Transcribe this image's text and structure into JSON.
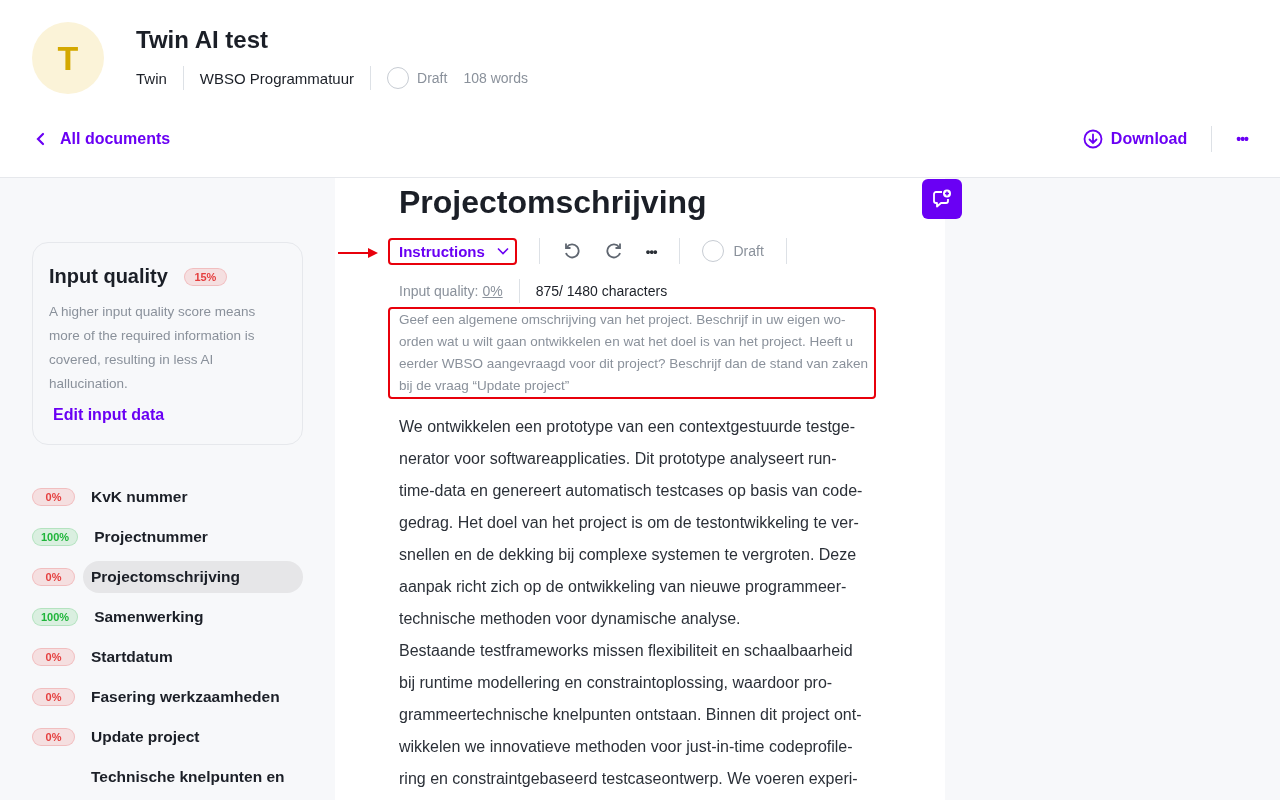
{
  "header": {
    "avatar_letter": "T",
    "title": "Twin AI test",
    "meta": [
      "Twin",
      "WBSO Programmatuur"
    ],
    "status": "Draft",
    "word_count": "108 words"
  },
  "nav": {
    "back": "All documents",
    "download": "Download",
    "more": "•••"
  },
  "sidebar": {
    "card": {
      "title": "Input quality",
      "score": "15%",
      "description": "A higher input quality score means more of the required information is covered, resulting in less AI hallucination.",
      "link": "Edit input data"
    },
    "items": [
      {
        "score": "0%",
        "color": "#e53e3e",
        "label": "KvK nummer",
        "selected": false
      },
      {
        "score": "100%",
        "color": "#1fb53a",
        "label": "Projectnummer",
        "selected": false
      },
      {
        "score": "0%",
        "color": "#e53e3e",
        "label": "Projectomschrijving",
        "selected": true
      },
      {
        "score": "100%",
        "color": "#1fb53a",
        "label": "Samenwerking",
        "selected": false
      },
      {
        "score": "0%",
        "color": "#e53e3e",
        "label": "Startdatum",
        "selected": false
      },
      {
        "score": "0%",
        "color": "#e53e3e",
        "label": "Fasering werkzaamheden",
        "selected": false
      },
      {
        "score": "0%",
        "color": "#e53e3e",
        "label": "Update project",
        "selected": false
      },
      {
        "label": "Technische knelpunten en",
        "selected": false
      }
    ]
  },
  "document": {
    "title": "Projectomschrijving",
    "toolbar": {
      "instructions": "Instructions",
      "more": "•••",
      "status": "Draft"
    },
    "input_quality_label": "Input quality:",
    "input_quality_value": "0%",
    "characters": "875/ 1480 characters",
    "instructions": [
      "Geef een algemene omschrijving van het project. Beschrijf in uw eigen wo-",
      "orden wat u wilt gaan ontwikkelen en wat het doel is van het project. Heeft u",
      "eerder WBSO aangevraagd voor dit project? Beschrijf dan de stand van zaken",
      "bij de vraag “Update project”"
    ],
    "paragraphs": [
      [
        "We ontwikkelen een prototype van een contextgestuurde testge-",
        "nerator voor softwareapplicaties. Dit prototype analyseert run-",
        "time-data en genereert automatisch testcases op basis van code-",
        "gedrag. Het doel van het project is om de testontwikkeling te ver-",
        "snellen en de dekking bij complexe systemen te vergroten. Deze",
        "aanpak richt zich op de ontwikkeling van nieuwe programmeer-",
        "technische methoden voor dynamische analyse."
      ],
      [
        "Bestaande testframeworks missen flexibiliteit en schaalbaarheid",
        "bij runtime modellering en constraintoplossing, waardoor pro-",
        "grammeertechnische knelpunten ontstaan. Binnen dit project ont-",
        "wikkelen we innovatieve methoden voor just-in-time codeprofile-",
        "ring en constraintgebaseerd testcaseontwerp. We voeren experi-"
      ]
    ]
  }
}
